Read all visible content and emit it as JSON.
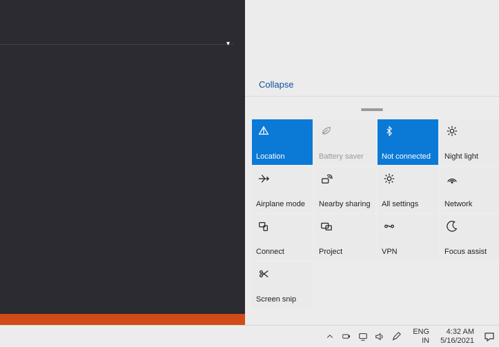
{
  "action_center": {
    "collapse_label": "Collapse",
    "tiles": {
      "location": {
        "label": "Location",
        "active": true
      },
      "battery_saver": {
        "label": "Battery saver",
        "disabled": true
      },
      "bluetooth": {
        "label": "Not connected",
        "active": true
      },
      "night_light": {
        "label": "Night light"
      },
      "airplane": {
        "label": "Airplane mode"
      },
      "nearby": {
        "label": "Nearby sharing"
      },
      "settings": {
        "label": "All settings"
      },
      "network": {
        "label": "Network"
      },
      "connect": {
        "label": "Connect"
      },
      "project": {
        "label": "Project"
      },
      "vpn": {
        "label": "VPN"
      },
      "focus": {
        "label": "Focus assist"
      },
      "snip": {
        "label": "Screen snip"
      }
    }
  },
  "taskbar": {
    "language_top": "ENG",
    "language_bottom": "IN",
    "time": "4:32 AM",
    "date": "5/16/2021"
  }
}
